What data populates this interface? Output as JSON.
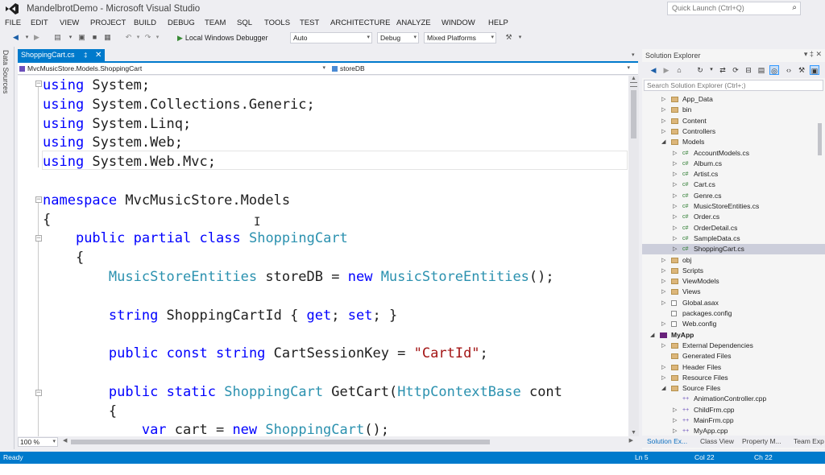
{
  "window": {
    "title": "MandelbrotDemo - Microsoft Visual Studio"
  },
  "quick_launch": {
    "placeholder": "Quick Launch (Ctrl+Q)",
    "icon": "search-icon"
  },
  "menu": [
    "FILE",
    "EDIT",
    "VIEW",
    "PROJECT",
    "BUILD",
    "DEBUG",
    "TEAM",
    "SQL",
    "TOOLS",
    "TEST",
    "ARCHITECTURE",
    "ANALYZE",
    "WINDOW",
    "HELP"
  ],
  "toolbar": {
    "run_label": "Local Windows Debugger",
    "target": "Auto",
    "configuration": "Debug",
    "platform": "Mixed Platforms"
  },
  "side_tab": {
    "label": "Data Sources"
  },
  "doc_tab": {
    "label": "ShoppingCart.cs"
  },
  "navbar": {
    "type_path": "MvcMusicStore.Models.ShoppingCart",
    "member": "storeDB"
  },
  "code_lines": [
    [
      {
        "t": "using",
        "c": "kw"
      },
      {
        "t": " System;",
        "c": ""
      }
    ],
    [
      {
        "t": "using",
        "c": "kw"
      },
      {
        "t": " System.Collections.Generic;",
        "c": ""
      }
    ],
    [
      {
        "t": "using",
        "c": "kw"
      },
      {
        "t": " System.Linq;",
        "c": ""
      }
    ],
    [
      {
        "t": "using",
        "c": "kw"
      },
      {
        "t": " System.Web;",
        "c": ""
      }
    ],
    [
      {
        "t": "using",
        "c": "kw"
      },
      {
        "t": " System.Web.Mvc;",
        "c": ""
      }
    ],
    [],
    [
      {
        "t": "namespace",
        "c": "kw"
      },
      {
        "t": " MvcMusicStore.Models",
        "c": ""
      }
    ],
    [
      {
        "t": "{",
        "c": ""
      }
    ],
    [
      {
        "t": "    ",
        "c": ""
      },
      {
        "t": "public",
        "c": "kw"
      },
      {
        "t": " ",
        "c": ""
      },
      {
        "t": "partial",
        "c": "kw"
      },
      {
        "t": " ",
        "c": ""
      },
      {
        "t": "class",
        "c": "kw"
      },
      {
        "t": " ",
        "c": ""
      },
      {
        "t": "ShoppingCart",
        "c": "ty"
      }
    ],
    [
      {
        "t": "    {",
        "c": ""
      }
    ],
    [
      {
        "t": "        ",
        "c": ""
      },
      {
        "t": "MusicStoreEntities",
        "c": "ty"
      },
      {
        "t": " storeDB = ",
        "c": ""
      },
      {
        "t": "new",
        "c": "kw"
      },
      {
        "t": " ",
        "c": ""
      },
      {
        "t": "MusicStoreEntities",
        "c": "ty"
      },
      {
        "t": "();",
        "c": ""
      }
    ],
    [],
    [
      {
        "t": "        ",
        "c": ""
      },
      {
        "t": "string",
        "c": "kw"
      },
      {
        "t": " ShoppingCartId { ",
        "c": ""
      },
      {
        "t": "get",
        "c": "kw"
      },
      {
        "t": "; ",
        "c": ""
      },
      {
        "t": "set",
        "c": "kw"
      },
      {
        "t": "; }",
        "c": ""
      }
    ],
    [],
    [
      {
        "t": "        ",
        "c": ""
      },
      {
        "t": "public",
        "c": "kw"
      },
      {
        "t": " ",
        "c": ""
      },
      {
        "t": "const",
        "c": "kw"
      },
      {
        "t": " ",
        "c": ""
      },
      {
        "t": "string",
        "c": "kw"
      },
      {
        "t": " CartSessionKey = ",
        "c": ""
      },
      {
        "t": "\"CartId\"",
        "c": "st"
      },
      {
        "t": ";",
        "c": ""
      }
    ],
    [],
    [
      {
        "t": "        ",
        "c": ""
      },
      {
        "t": "public",
        "c": "kw"
      },
      {
        "t": " ",
        "c": ""
      },
      {
        "t": "static",
        "c": "kw"
      },
      {
        "t": " ",
        "c": ""
      },
      {
        "t": "ShoppingCart",
        "c": "ty"
      },
      {
        "t": " GetCart(",
        "c": ""
      },
      {
        "t": "HttpContextBase",
        "c": "ty"
      },
      {
        "t": " cont",
        "c": ""
      }
    ],
    [
      {
        "t": "        {",
        "c": ""
      }
    ],
    [
      {
        "t": "            ",
        "c": ""
      },
      {
        "t": "var",
        "c": "kw"
      },
      {
        "t": " cart = ",
        "c": ""
      },
      {
        "t": "new",
        "c": "kw"
      },
      {
        "t": " ",
        "c": ""
      },
      {
        "t": "ShoppingCart",
        "c": "ty"
      },
      {
        "t": "();",
        "c": ""
      }
    ]
  ],
  "zoom": "100 %",
  "solution_explorer": {
    "title": "Solution Explorer",
    "search_placeholder": "Search Solution Explorer (Ctrl+;)",
    "tree": [
      {
        "label": "App_Data",
        "depth": 1,
        "icon": "folder-icon",
        "expander": "collapsed"
      },
      {
        "label": "bin",
        "depth": 1,
        "icon": "folder-icon",
        "expander": "collapsed"
      },
      {
        "label": "Content",
        "depth": 1,
        "icon": "folder-icon",
        "expander": "collapsed"
      },
      {
        "label": "Controllers",
        "depth": 1,
        "icon": "folder-icon",
        "expander": "collapsed"
      },
      {
        "label": "Models",
        "depth": 1,
        "icon": "folder-icon",
        "expander": "expanded"
      },
      {
        "label": "AccountModels.cs",
        "depth": 2,
        "icon": "cs-file-icon",
        "expander": "collapsed"
      },
      {
        "label": "Album.cs",
        "depth": 2,
        "icon": "cs-file-icon",
        "expander": "collapsed"
      },
      {
        "label": "Artist.cs",
        "depth": 2,
        "icon": "cs-file-icon",
        "expander": "collapsed"
      },
      {
        "label": "Cart.cs",
        "depth": 2,
        "icon": "cs-file-icon",
        "expander": "collapsed"
      },
      {
        "label": "Genre.cs",
        "depth": 2,
        "icon": "cs-file-icon",
        "expander": "collapsed"
      },
      {
        "label": "MusicStoreEntities.cs",
        "depth": 2,
        "icon": "cs-file-icon",
        "expander": "collapsed"
      },
      {
        "label": "Order.cs",
        "depth": 2,
        "icon": "cs-file-icon",
        "expander": "collapsed"
      },
      {
        "label": "OrderDetail.cs",
        "depth": 2,
        "icon": "cs-file-icon",
        "expander": "collapsed"
      },
      {
        "label": "SampleData.cs",
        "depth": 2,
        "icon": "cs-file-icon",
        "expander": "collapsed"
      },
      {
        "label": "ShoppingCart.cs",
        "depth": 2,
        "icon": "cs-file-icon",
        "expander": "collapsed",
        "selected": true
      },
      {
        "label": "obj",
        "depth": 1,
        "icon": "folder-icon",
        "expander": "collapsed"
      },
      {
        "label": "Scripts",
        "depth": 1,
        "icon": "folder-icon",
        "expander": "collapsed"
      },
      {
        "label": "ViewModels",
        "depth": 1,
        "icon": "folder-icon",
        "expander": "collapsed"
      },
      {
        "label": "Views",
        "depth": 1,
        "icon": "folder-icon",
        "expander": "collapsed"
      },
      {
        "label": "Global.asax",
        "depth": 1,
        "icon": "file-icon",
        "expander": "collapsed"
      },
      {
        "label": "packages.config",
        "depth": 1,
        "icon": "file-icon",
        "expander": "none"
      },
      {
        "label": "Web.config",
        "depth": 1,
        "icon": "file-icon",
        "expander": "collapsed"
      },
      {
        "label": "MyApp",
        "depth": 0,
        "icon": "project-icon",
        "expander": "expanded",
        "bold": true
      },
      {
        "label": "External Dependencies",
        "depth": 1,
        "icon": "folder-icon",
        "expander": "collapsed"
      },
      {
        "label": "Generated Files",
        "depth": 1,
        "icon": "folder-icon",
        "expander": "none"
      },
      {
        "label": "Header Files",
        "depth": 1,
        "icon": "folder-icon",
        "expander": "collapsed"
      },
      {
        "label": "Resource Files",
        "depth": 1,
        "icon": "folder-icon",
        "expander": "collapsed"
      },
      {
        "label": "Source Files",
        "depth": 1,
        "icon": "folder-icon",
        "expander": "expanded"
      },
      {
        "label": "AnimationController.cpp",
        "depth": 2,
        "icon": "cpp-file-icon",
        "expander": "none"
      },
      {
        "label": "ChildFrm.cpp",
        "depth": 2,
        "icon": "cpp-file-icon",
        "expander": "collapsed"
      },
      {
        "label": "MainFrm.cpp",
        "depth": 2,
        "icon": "cpp-file-icon",
        "expander": "collapsed"
      },
      {
        "label": "MyApp.cpp",
        "depth": 2,
        "icon": "cpp-file-icon",
        "expander": "collapsed"
      }
    ],
    "bottom_tabs": [
      "Solution Ex...",
      "Class View",
      "Property M...",
      "Team Exp"
    ]
  },
  "status": {
    "text": "Ready",
    "line": "Ln 5",
    "col": "Col 22",
    "ch": "Ch 22"
  },
  "colors": {
    "accent": "#007acc",
    "keyword": "#0000ff",
    "type": "#2b91af",
    "string": "#a31515"
  }
}
